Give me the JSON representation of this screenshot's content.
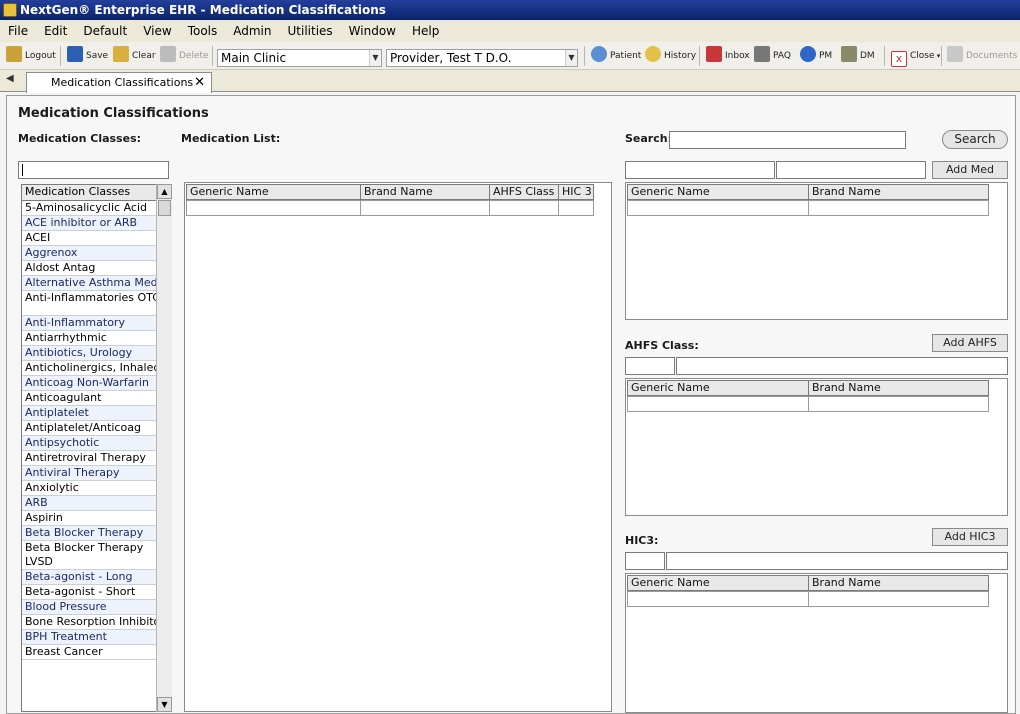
{
  "window": {
    "title": "NextGen® Enterprise EHR - Medication Classifications"
  },
  "menu": [
    "File",
    "Edit",
    "Default",
    "View",
    "Tools",
    "Admin",
    "Utilities",
    "Window",
    "Help"
  ],
  "toolbar": {
    "logout": "Logout",
    "save": "Save",
    "clear": "Clear",
    "delete": "Delete",
    "location": "Main Clinic",
    "provider": "Provider, Test T D.O.",
    "patient": "Patient",
    "history": "History",
    "inbox": "Inbox",
    "paq": "PAQ",
    "pm": "PM",
    "dm": "DM",
    "close": "Close",
    "documents": "Documents"
  },
  "tab": {
    "label": "Medication Classifications"
  },
  "page": {
    "title": "Medication Classifications",
    "classes_label": "Medication Classes:",
    "list_label": "Medication List:",
    "search_label": "Search:",
    "search_button": "Search",
    "add_med": "Add Med",
    "ahfs_label": "AHFS Class:",
    "add_ahfs": "Add AHFS",
    "hic3_label": "HIC3:",
    "add_hic3": "Add HIC3"
  },
  "classes_header": "Medication Classes",
  "classes": [
    "5-Aminosalicyclic Acid",
    "ACE inhibitor or ARB",
    "ACEI",
    "Aggrenox",
    "Aldost Antag",
    "Alternative Asthma Med",
    "Anti-Inflammatories OTC",
    "Anti-Inflammatory",
    "Antiarrhythmic",
    "Antibiotics, Urology",
    "Anticholinergics, Inhaled",
    "Anticoag Non-Warfarin",
    "Anticoagulant",
    "Antiplatelet",
    "Antiplatelet/Anticoag",
    "Antipsychotic",
    "Antiretroviral Therapy",
    "Antiviral Therapy",
    "Anxiolytic",
    "ARB",
    "Aspirin",
    "Beta Blocker Therapy",
    "Beta Blocker Therapy LVSD",
    "Beta-agonist - Long",
    "Beta-agonist - Short",
    "Blood Pressure",
    "Bone Resorption Inhibitor",
    "BPH Treatment",
    "Breast Cancer"
  ],
  "med_list_columns": [
    "Generic Name",
    "Brand Name",
    "AHFS Class",
    "HIC 3"
  ],
  "grid_columns": [
    "Generic Name",
    "Brand Name"
  ],
  "colors": {
    "title_bar": "#0a246a",
    "row_alt": "#eef2fa",
    "link_text": "#1b2a66"
  }
}
